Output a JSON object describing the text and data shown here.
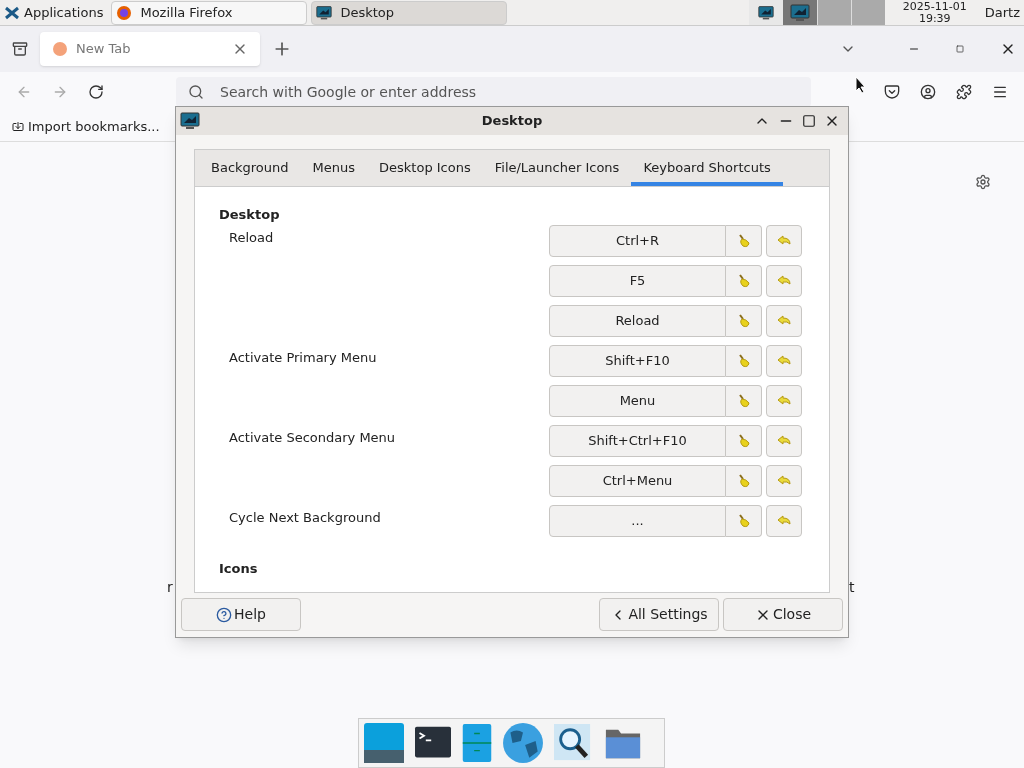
{
  "panel": {
    "menu": "Applications",
    "tasks": [
      {
        "label": "Mozilla Firefox",
        "selected": false
      },
      {
        "label": "Desktop",
        "selected": true
      }
    ],
    "date": "2025-11-01",
    "time": "19:39",
    "user": "Dartz"
  },
  "browser": {
    "tab": "New Tab",
    "search_placeholder": "Search with Google or enter address",
    "bookmark": "Import bookmarks...",
    "fragments": [
      "r",
      "t"
    ]
  },
  "dialog": {
    "title": "Desktop",
    "tabs": [
      {
        "label": "Background",
        "selected": false
      },
      {
        "label": "Menus",
        "selected": false
      },
      {
        "label": "Desktop Icons",
        "selected": false
      },
      {
        "label": "File/Launcher Icons",
        "selected": false
      },
      {
        "label": "Keyboard Shortcuts",
        "selected": true
      }
    ],
    "sections": [
      {
        "title": "Desktop",
        "actions": [
          {
            "label": "Reload",
            "shortcuts": [
              "Ctrl+R",
              "F5",
              "Reload"
            ]
          },
          {
            "label": "Activate Primary Menu",
            "shortcuts": [
              "Shift+F10",
              "Menu"
            ]
          },
          {
            "label": "Activate Secondary Menu",
            "shortcuts": [
              "Shift+Ctrl+F10",
              "Ctrl+Menu"
            ]
          },
          {
            "label": "Cycle Next Background",
            "shortcuts": [
              "..."
            ]
          }
        ]
      },
      {
        "title": "Icons"
      }
    ],
    "buttons": {
      "help": "Help",
      "back": "All Settings",
      "close": "Close"
    }
  }
}
